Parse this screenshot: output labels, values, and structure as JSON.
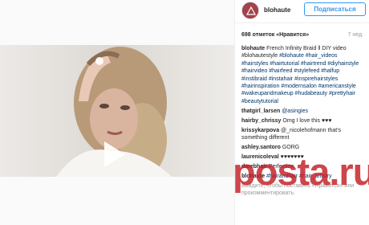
{
  "header": {
    "username": "blohaute",
    "follow_label": "Подписаться"
  },
  "post": {
    "likes_text": "698 отметок «Нравится»",
    "date_text": "7 нед."
  },
  "caption": {
    "username": "blohaute",
    "text": "French Infinity Braid ll DIY video #blohautestyle",
    "hashtags": "#blohaute #hair_videos #hairstyles #hairtutorial #hairtrend #diyhairstyle #hairvideo #hairfeed #stylefeed #halfup #instibraid #instahair #inspirehairstyles #hairinspiration #modernsalon #americanstyle #wakeupandmakeup #hudabeauty #prettyhair #beautytutorial"
  },
  "comments": [
    {
      "user": "thatgirl_larsen",
      "text": "@asingies"
    },
    {
      "user": "hairby_chrissy",
      "text": "Omg I love this ♥♥♥"
    },
    {
      "user": "krissykarpova",
      "text": "@_nicolehofmann that's something different"
    },
    {
      "user": "ashley.santoro",
      "text": "GORG"
    },
    {
      "user": "laurenicoleval",
      "text": "♥♥♥♥♥♥♥"
    },
    {
      "user": "darebhair",
      "text": "Perfection"
    },
    {
      "user": "blohaute",
      "text": "#hairandhair #hair_artistry"
    }
  ],
  "login_prompt": "Войдите, чтобы поставить «Нравится» или прокомментировать.",
  "watermark": "posta.ru",
  "colors": {
    "accent": "#3897f0",
    "watermark": "#c31c23"
  }
}
